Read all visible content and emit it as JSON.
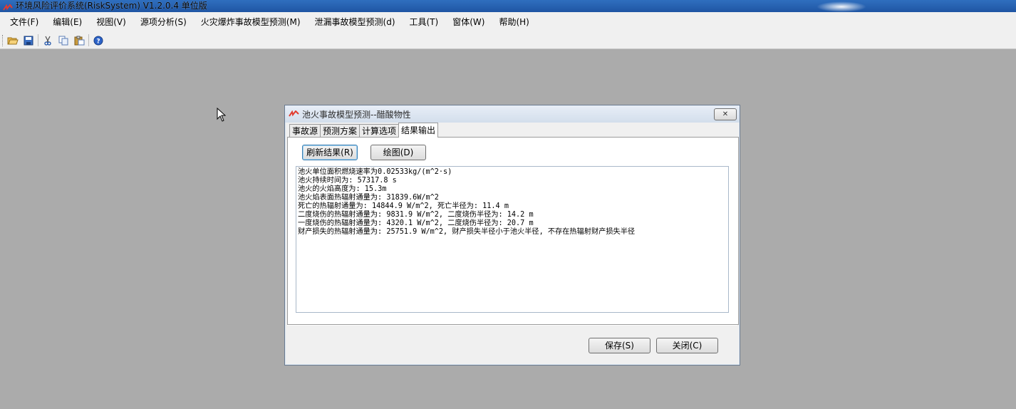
{
  "app": {
    "title": "环境风险评价系统(RiskSystem) V1.2.0.4 单位版"
  },
  "menu": {
    "items": [
      "文件(F)",
      "编辑(E)",
      "视图(V)",
      "源项分析(S)",
      "火灾爆炸事故模型预测(M)",
      "泄漏事故模型预测(d)",
      "工具(T)",
      "窗体(W)",
      "帮助(H)"
    ]
  },
  "toolbar": {
    "icons": [
      "open-folder-icon",
      "save-icon",
      "cut-icon",
      "copy-icon",
      "paste-icon",
      "help-icon"
    ]
  },
  "dialog": {
    "title": "池火事故模型预测--醋酸物性",
    "tabs": [
      "事故源",
      "预测方案",
      "计算选项",
      "结果输出"
    ],
    "active_tab": "结果输出",
    "refresh_button": "刷新结果(R)",
    "plot_button": "绘图(D)",
    "results": [
      "池火单位面积燃烧速率为0.02533kg/(m^2·s)",
      "池火持续时间为: 57317.8 s",
      "池火的火焰高度为: 15.3m",
      "池火焰表面热辐射通量为: 31839.6W/m^2",
      "死亡的热辐射通量为: 14844.9 W/m^2, 死亡半径为: 11.4 m",
      "二度烧伤的热辐射通量为: 9831.9 W/m^2, 二度烧伤半径为: 14.2 m",
      "一度烧伤的热辐射通量为: 4320.1 W/m^2, 二度烧伤半径为: 20.7 m",
      "财产损失的热辐射通量为: 25751.9 W/m^2, 财产损失半径小于池火半径, 不存在热辐射财产损失半径"
    ],
    "save_button": "保存(S)",
    "close_button": "关闭(C)"
  },
  "colors": {
    "desktop": "#ababab",
    "titlebar": "#1f55a3",
    "dialog_bg": "#f0f0f0"
  }
}
